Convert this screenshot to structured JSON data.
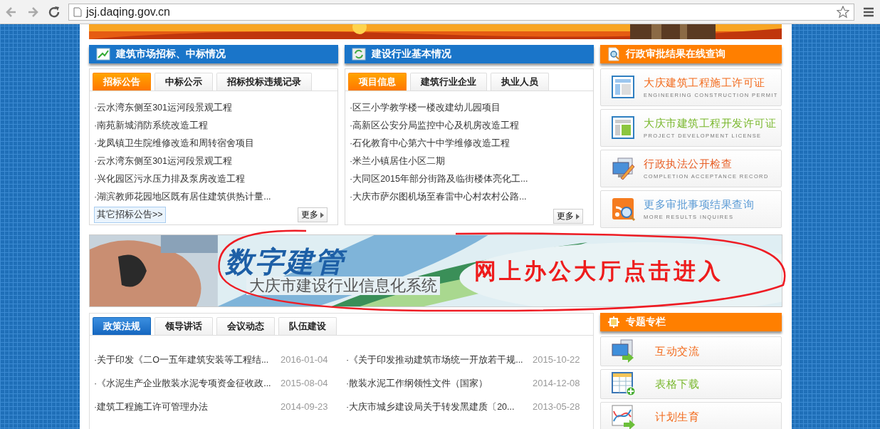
{
  "browser": {
    "url": "jsj.daqing.gov.cn"
  },
  "bidding": {
    "title": "建筑市场招标、中标情况",
    "tabs": [
      {
        "label": "招标公告",
        "selected": true
      },
      {
        "label": "中标公示",
        "selected": false
      },
      {
        "label": "招标投标违规记录",
        "selected": false
      }
    ],
    "items": [
      "·云水湾东侧至301运河段景观工程",
      "·南苑新城消防系统改造工程",
      "·龙凤镇卫生院维修改造和周转宿舍项目",
      "·云水湾东侧至301运河段景观工程",
      "·兴化园区污水压力排及泵房改造工程",
      "·湖滨教师花园地区既有居住建筑供热计量..."
    ],
    "other_link": "其它招标公告>>",
    "more": "更多"
  },
  "industry": {
    "title": "建设行业基本情况",
    "tabs": [
      {
        "label": "项目信息",
        "selected": true
      },
      {
        "label": "建筑行业企业",
        "selected": false
      },
      {
        "label": "执业人员",
        "selected": false
      }
    ],
    "items": [
      "·区三小学教学楼一楼改建幼儿园项目",
      "·高新区公安分局监控中心及机房改造工程",
      "·石化教育中心第六十中学维修改造工程",
      "·米兰小镇居住小区二期",
      "·大同区2015年部分街路及临街楼体亮化工...",
      "·大庆市萨尔图机场至春雷中心村农村公路..."
    ],
    "more": "更多"
  },
  "approval": {
    "title": "行政审批结果在线查询",
    "links": [
      {
        "kind": "permit",
        "title": "大庆建筑工程施工许可证",
        "subtitle": "ENGINEERING CONSTRUCTION PERMIT",
        "color": "#f26b1d"
      },
      {
        "kind": "license",
        "title": "大庆市建筑工程开发许可证",
        "subtitle": "PROJECT DEVELOPMENT LICENSE",
        "color": "#7ab82e"
      },
      {
        "kind": "inspect",
        "title": "行政执法公开检查",
        "subtitle": "COMPLETION ACCEPTANCE RECORD",
        "color": "#e8622a"
      },
      {
        "kind": "search",
        "title": "更多审批事项结果查询",
        "subtitle": "MORE RESULTS INQUIRES",
        "color": "#5b9bd5"
      }
    ]
  },
  "banner": {
    "logo": "数字建管",
    "subtitle": "大庆市建设行业信息化系统",
    "cta": "网上办公大厅点击进入"
  },
  "policy": {
    "tabs": [
      {
        "label": "政策法规",
        "selected": true
      },
      {
        "label": "领导讲话",
        "selected": false
      },
      {
        "label": "会议动态",
        "selected": false
      },
      {
        "label": "队伍建设",
        "selected": false
      }
    ],
    "items": [
      {
        "title": "·关于印发《二O一五年建筑安装等工程结...",
        "date": "2016-01-04"
      },
      {
        "title": "·《关于印发推动建筑市场统一开放若干规...",
        "date": "2015-10-22"
      },
      {
        "title": "·《水泥生产企业散装水泥专项资金征收政...",
        "date": "2015-08-04"
      },
      {
        "title": "·散装水泥工作纲领性文件（国家）",
        "date": "2014-12-08"
      },
      {
        "title": "·建筑工程施工许可管理办法",
        "date": "2014-09-23"
      },
      {
        "title": "·大庆市城乡建设局关于转发黑建质〔20...",
        "date": "2013-05-28"
      }
    ]
  },
  "topics": {
    "title": "专题专栏",
    "links": [
      {
        "kind": "exchange",
        "title": "互动交流",
        "color": "#f26b1d"
      },
      {
        "kind": "table",
        "title": "表格下载",
        "color": "#7ab82e"
      },
      {
        "kind": "chart",
        "title": "计划生育",
        "color": "#f26b1d"
      }
    ]
  }
}
